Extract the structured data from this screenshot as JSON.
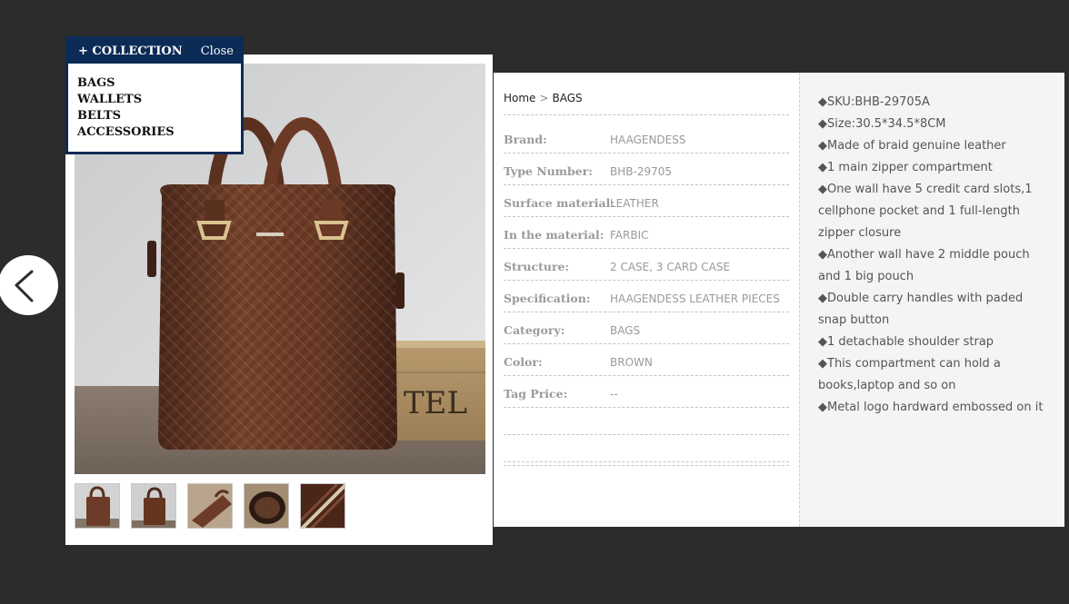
{
  "collection": {
    "title": "+ COLLECTION",
    "close_label": "Close",
    "items": [
      "BAGS",
      "WALLETS",
      "BELTS",
      "ACCESSORIES"
    ]
  },
  "nav": {
    "prev_icon": "chevron-left-icon"
  },
  "product_image": {
    "main_description_sign": "TEL",
    "thumbnail_count": 5
  },
  "breadcrumb": {
    "home": "Home",
    "separator": ">",
    "current": "BAGS"
  },
  "specs": [
    {
      "label": "Brand:",
      "value": "HAAGENDESS"
    },
    {
      "label": "Type Number:",
      "value": "BHB-29705"
    },
    {
      "label": "Surface material:",
      "value": "LEATHER"
    },
    {
      "label": "In the material:",
      "value": "FARBIC"
    },
    {
      "label": "Structure:",
      "value": "2 CASE, 3 CARD CASE"
    },
    {
      "label": "Specification:",
      "value": "HAAGENDESS LEATHER PIECES"
    },
    {
      "label": "Category:",
      "value": "BAGS"
    },
    {
      "label": "Color:",
      "value": "BROWN"
    },
    {
      "label": "Tag Price:",
      "value": "--"
    }
  ],
  "features": [
    "◆SKU:BHB-29705A",
    "◆Size:30.5*34.5*8CM",
    "◆Made of braid genuine leather",
    "◆1 main zipper compartment",
    "◆One wall have 5 credit card slots,1 cellphone pocket and 1 full-length zipper closure",
    "◆Another wall have 2 middle pouch and 1 big pouch",
    "◆Double carry handles with paded snap button",
    "◆1 detachable shoulder strap",
    "◆This compartment can hold a books,laptop and so on",
    "◆Metal logo hardward embossed on it"
  ],
  "colors": {
    "background": "#2b2c2b",
    "collection_navy": "#0c2b57",
    "leather_brown": "#6a3a26",
    "feature_panel": "#f4f4f4"
  }
}
